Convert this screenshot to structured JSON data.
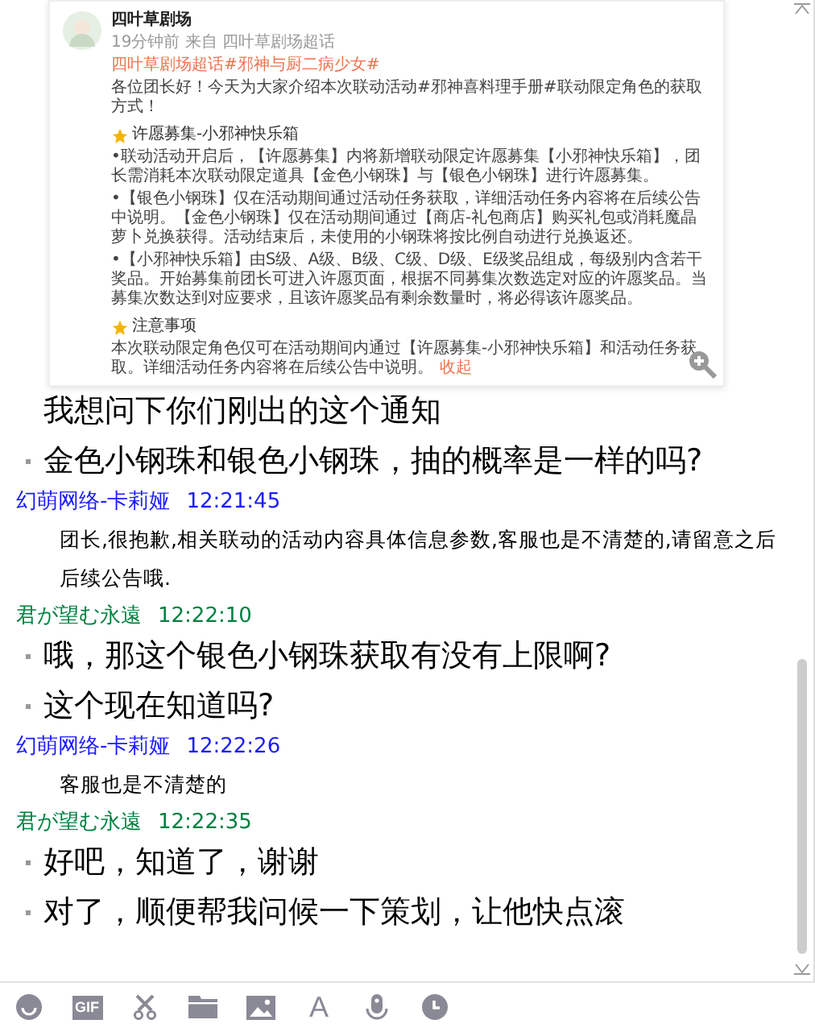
{
  "post": {
    "author": "四叶草剧场",
    "meta": "19分钟前  来自  四叶草剧场超话",
    "tags": "四叶草剧场超话#邪神与厨二病少女#",
    "intro": "各位团长好！今天为大家介绍本次联动活动#邪神喜料理手册#联动限定角色的获取方式！",
    "sections": [
      {
        "heading": "许愿募集-小邪神快乐箱",
        "paragraphs": [
          "•联动活动开启后，【许愿募集】内将新增联动限定许愿募集【小邪神快乐箱】，团长需消耗本次联动限定道具【金色小钢珠】与【银色小钢珠】进行许愿募集。",
          "•【银色小钢珠】仅在活动期间通过活动任务获取，详细活动任务内容将在后续公告中说明。【金色小钢珠】仅在活动期间通过【商店-礼包商店】购买礼包或消耗魔晶萝卜兑换获得。活动结束后，未使用的小钢珠将按比例自动进行兑换返还。",
          "•【小邪神快乐箱】由S级、A级、B级、C级、D级、E级奖品组成，每级别内含若干奖品。开始募集前团长可进入许愿页面，根据不同募集次数选定对应的许愿奖品。当募集次数达到对应要求，且该许愿奖品有剩余数量时，将必得该许愿奖品。"
        ]
      },
      {
        "heading": "注意事项",
        "paragraphs": [
          "本次联动限定角色仅可在活动期间内通过【许愿募集-小邪神快乐箱】和活动任务获取。详细活动任务内容将在后续公告中说明。"
        ]
      }
    ],
    "collapse": "收起"
  },
  "messages": [
    {
      "kind": "large",
      "lines": [
        {
          "text": "我想问下你们刚出的这个通知",
          "bullet": false
        },
        {
          "text": "金色小钢珠和银色小钢珠，抽的概率是一样的吗?",
          "bullet": true
        }
      ]
    },
    {
      "kind": "small",
      "sender": "幻萌网络-卡莉娅",
      "time": "12:21:45",
      "color": "#1a1aff",
      "lines": [
        {
          "text": "团长,很抱歉,相关联动的活动内容具体信息参数,客服也是不清楚的,请留意之后后续公告哦.",
          "bullet": false
        }
      ]
    },
    {
      "kind": "large",
      "sender": "君が望む永遠",
      "time": "12:22:10",
      "color": "#008040",
      "lines": [
        {
          "text": "哦，那这个银色小钢珠获取有没有上限啊?",
          "bullet": true
        },
        {
          "text": "这个现在知道吗?",
          "bullet": true
        }
      ]
    },
    {
      "kind": "small",
      "sender": "幻萌网络-卡莉娅",
      "time": "12:22:26",
      "color": "#1a1aff",
      "lines": [
        {
          "text": "客服也是不清楚的",
          "bullet": false
        }
      ]
    },
    {
      "kind": "large",
      "sender": "君が望む永遠",
      "time": "12:22:35",
      "color": "#008040",
      "lines": [
        {
          "text": "好吧，知道了，谢谢",
          "bullet": true
        },
        {
          "text": "对了，顺便帮我问候一下策划，让他快点滚",
          "bullet": true
        }
      ]
    }
  ],
  "toolbar": [
    {
      "kind": "emoji"
    },
    {
      "kind": "gif",
      "text": "GIF"
    },
    {
      "kind": "scissors"
    },
    {
      "kind": "folder"
    },
    {
      "kind": "image"
    },
    {
      "kind": "font",
      "text": "A"
    },
    {
      "kind": "mic"
    },
    {
      "kind": "clock"
    }
  ]
}
